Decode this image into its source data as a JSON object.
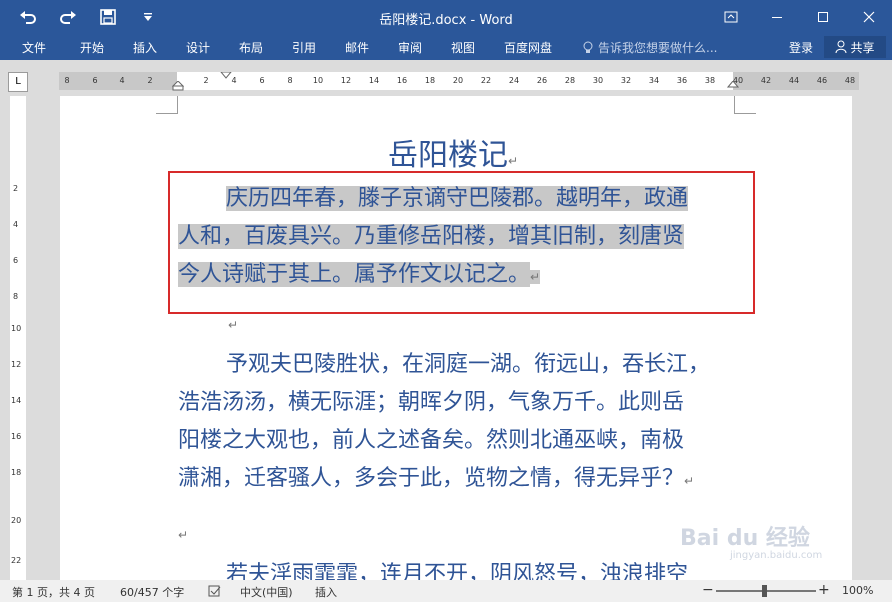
{
  "window": {
    "title": "岳阳楼记.docx - Word",
    "theme_color": "#2b579a"
  },
  "quick_access": {
    "undo_icon": "undo-icon",
    "redo_icon": "redo-icon",
    "save_icon": "save-icon",
    "customize_icon": "customize-icon"
  },
  "ribbon": {
    "tabs": [
      "文件",
      "开始",
      "插入",
      "设计",
      "布局",
      "引用",
      "邮件",
      "审阅",
      "视图",
      "百度网盘"
    ],
    "tell_me": "告诉我您想要做什么...",
    "login": "登录",
    "share": "共享"
  },
  "ruler": {
    "corner_label": "L",
    "left_ticks": [
      "8",
      "6",
      "4",
      "2"
    ],
    "main_ticks": [
      "2",
      "4",
      "6",
      "8",
      "10",
      "12",
      "14",
      "16",
      "18",
      "20",
      "22",
      "24",
      "26",
      "28",
      "30",
      "32",
      "34",
      "36",
      "38"
    ],
    "right_ticks": [
      "40",
      "42",
      "44",
      "46",
      "48"
    ],
    "vertical_ticks": [
      "2",
      "4",
      "6",
      "8",
      "10",
      "12",
      "14",
      "16",
      "18",
      "20",
      "22"
    ]
  },
  "document": {
    "heading": "岳阳楼记",
    "para1_lines": [
      "庆历四年春，滕子京谪守巴陵郡。越明年，政通",
      "人和，百废具兴。乃重修岳阳楼，增其旧制，刻唐贤",
      "今人诗赋于其上。属予作文以记之。"
    ],
    "para2_lines": [
      "予观夫巴陵胜状，在洞庭一湖。衔远山，吞长江，",
      "浩浩汤汤，横无际涯；朝晖夕阴，气象万千。此则岳",
      "阳楼之大观也，前人之述备矣。然则北通巫峡，南极",
      "潇湘，迁客骚人，多会于此，览物之情，得无异乎？"
    ],
    "para3_partial": "若夫淫雨霏霏，连月不开，阴风怒号，浊浪排空",
    "pilcrow": "↵",
    "selection_color": "#c8c8c8",
    "highlight_box_color": "#d72a2a",
    "text_color": "#2f5496"
  },
  "status_bar": {
    "page": "第 1 页，共 4 页",
    "words": "60/457 个字",
    "language": "中文(中国)",
    "mode": "插入",
    "zoom": "100%",
    "zoom_minus": "−",
    "zoom_plus": "+"
  },
  "watermark": {
    "text": "Bai du 经验",
    "sub": "jingyan.baidu.com"
  }
}
